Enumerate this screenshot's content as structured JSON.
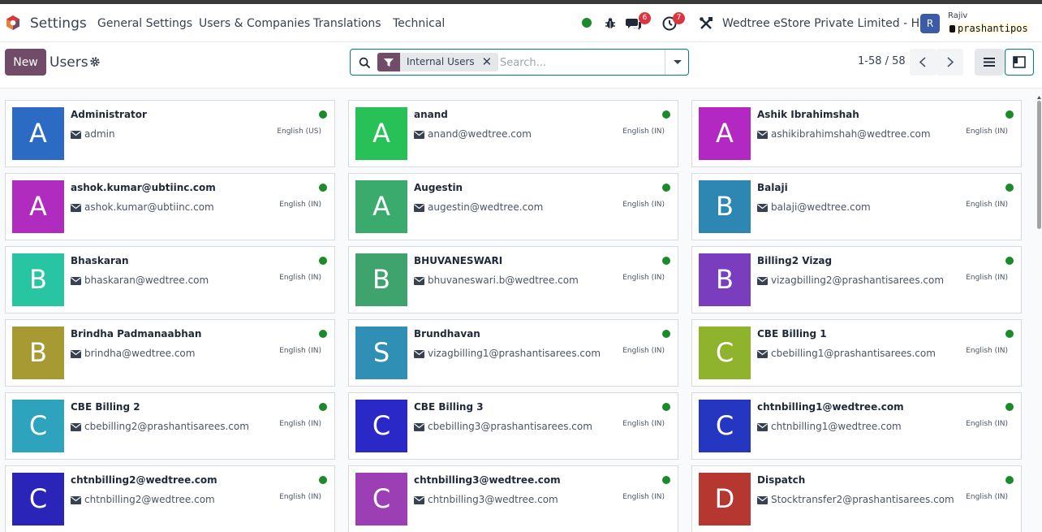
{
  "navbar": {
    "app_name": "Settings",
    "menus": [
      "General Settings",
      "Users & Companies",
      "Translations",
      "Technical"
    ],
    "chat_badge": "6",
    "activity_badge": "7",
    "company": "Wedtree eStore Private Limited - HO",
    "user_initial": "R",
    "user_name": "Rajiv",
    "database": "prashantipos",
    "status_color": "#1a8a2a"
  },
  "control": {
    "new_label": "New",
    "title": "Users",
    "facet_label": "Internal Users",
    "search_placeholder": "Search...",
    "pager": "1-58 / 58"
  },
  "colors": {
    "brand": "#714b67",
    "accent": "#017e84",
    "online": "#1a8a2a"
  },
  "cards": [
    {
      "initial": "A",
      "name": "Administrator",
      "email": "admin",
      "lang": "English (US)",
      "color": "#2b6bc4"
    },
    {
      "initial": "A",
      "name": "anand",
      "email": "anand@wedtree.com",
      "lang": "English (IN)",
      "color": "#27c158"
    },
    {
      "initial": "A",
      "name": "Ashik Ibrahimshah",
      "email": "ashikibrahimshah@wedtree.com",
      "lang": "English (IN)",
      "color": "#b327c2"
    },
    {
      "initial": "A",
      "name": "ashok.kumar@ubtiinc.com",
      "email": "ashok.kumar@ubtiinc.com",
      "lang": "English (IN)",
      "color": "#b02cbf"
    },
    {
      "initial": "A",
      "name": "Augestin",
      "email": "augestin@wedtree.com",
      "lang": "English (IN)",
      "color": "#3aab6d"
    },
    {
      "initial": "B",
      "name": "Balaji",
      "email": "balaji@wedtree.com",
      "lang": "English (IN)",
      "color": "#2e86b3"
    },
    {
      "initial": "B",
      "name": "Bhaskaran",
      "email": "bhaskaran@wedtree.com",
      "lang": "English (IN)",
      "color": "#27c5a2"
    },
    {
      "initial": "B",
      "name": "BHUVANESWARI",
      "email": "bhuvaneswari.b@wedtree.com",
      "lang": "English (IN)",
      "color": "#3ea36d"
    },
    {
      "initial": "B",
      "name": "Billing2 Vizag",
      "email": "vizagbilling2@prashantisarees.com",
      "lang": "English (IN)",
      "color": "#7a3dbd"
    },
    {
      "initial": "B",
      "name": "Brindha Padmanaabhan",
      "email": "brindha@wedtree.com",
      "lang": "English (IN)",
      "color": "#a89a32"
    },
    {
      "initial": "S",
      "name": "Brundhavan",
      "email": "vizagbilling1@prashantisarees.com",
      "lang": "English (IN)",
      "color": "#2f8fb4"
    },
    {
      "initial": "C",
      "name": "CBE Billing 1",
      "email": "cbebilling1@prashantisarees.com",
      "lang": "English (IN)",
      "color": "#8fb32d"
    },
    {
      "initial": "C",
      "name": "CBE Billing 2",
      "email": "cbebilling2@prashantisarees.com",
      "lang": "English (IN)",
      "color": "#2ea3bd"
    },
    {
      "initial": "C",
      "name": "CBE Billing 3",
      "email": "cbebilling3@prashantisarees.com",
      "lang": "English (IN)",
      "color": "#2a28c6"
    },
    {
      "initial": "C",
      "name": "chtnbilling1@wedtree.com",
      "email": "chtnbilling1@wedtree.com",
      "lang": "English (IN)",
      "color": "#2536c0"
    },
    {
      "initial": "C",
      "name": "chtnbilling2@wedtree.com",
      "email": "chtnbilling2@wedtree.com",
      "lang": "English (IN)",
      "color": "#2a24b8"
    },
    {
      "initial": "C",
      "name": "chtnbilling3@wedtree.com",
      "email": "chtnbilling3@wedtree.com",
      "lang": "English (IN)",
      "color": "#9c3fb4"
    },
    {
      "initial": "D",
      "name": "Dispatch",
      "email": "Stocktransfer2@prashantisarees.com",
      "lang": "English (IN)",
      "color": "#b5372f"
    }
  ]
}
